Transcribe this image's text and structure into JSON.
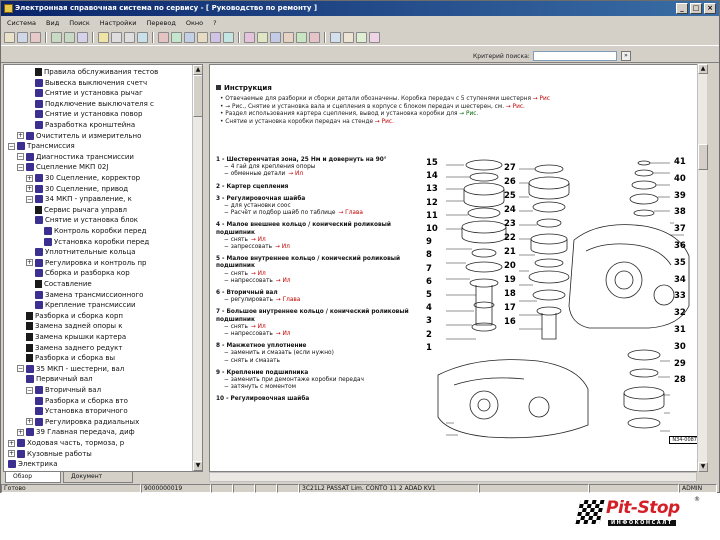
{
  "window": {
    "title": "Электронная справочная система по сервису - [ Руководство по ремонту ]",
    "buttons": [
      "_",
      "□",
      "×"
    ]
  },
  "menu": [
    "Система",
    "Вид",
    "Поиск",
    "Настройки",
    "Перевод",
    "Окно",
    "?"
  ],
  "search": {
    "label": "Критерий поиска:",
    "value": "",
    "go": "»"
  },
  "tree": {
    "items": [
      {
        "level": 4,
        "icon": "page",
        "expander": "",
        "label": "Правила обслуживания   тестов"
      },
      {
        "level": 4,
        "icon": "book",
        "expander": "",
        "label": "Вывеска    выключения   счетч"
      },
      {
        "level": 4,
        "icon": "book",
        "expander": "",
        "label": "Снятие   и установка  рычаг"
      },
      {
        "level": 4,
        "icon": "book",
        "expander": "",
        "label": "Подключение  выключателя  с"
      },
      {
        "level": 4,
        "icon": "book",
        "expander": "",
        "label": "Снятие и установка  повор"
      },
      {
        "level": 4,
        "icon": "book",
        "expander": "",
        "label": "Разработка  кронштейна"
      },
      {
        "level": 2,
        "icon": "book",
        "expander": "+",
        "label": "Очиститель   и   измерительно"
      },
      {
        "level": 1,
        "icon": "book",
        "expander": "−",
        "label": "Трансмиссия"
      },
      {
        "level": 2,
        "icon": "book",
        "expander": "−",
        "label": "Диагностика  трансмиссии"
      },
      {
        "level": 2,
        "icon": "book",
        "expander": "−",
        "label": "Сцепление   МКП  02J"
      },
      {
        "level": 3,
        "icon": "book",
        "expander": "+",
        "label": "30  Сцепление,  корректор"
      },
      {
        "level": 3,
        "icon": "book",
        "expander": "+",
        "label": "30  Сцепление,  привод"
      },
      {
        "level": 3,
        "icon": "book",
        "expander": "−",
        "label": "34  МКП  -  управление,  к"
      },
      {
        "level": 4,
        "icon": "page",
        "expander": "",
        "label": "Сервис  рычага  управл"
      },
      {
        "level": 4,
        "icon": "book",
        "expander": "",
        "label": "Снятие  и установка  блок"
      },
      {
        "level": 5,
        "icon": "book",
        "expander": "",
        "label": "Контроль  коробки  перед"
      },
      {
        "level": 5,
        "icon": "book",
        "expander": "",
        "label": "Установка  коробки  перед"
      },
      {
        "level": 4,
        "icon": "book",
        "expander": "",
        "label": "Уплотнительные  кольца"
      },
      {
        "level": 3,
        "icon": "book",
        "expander": "+",
        "label": "Регулировка  и  контроль  пр"
      },
      {
        "level": 4,
        "icon": "book",
        "expander": "",
        "label": "Сборка  и  разборка  кор"
      },
      {
        "level": 4,
        "icon": "page",
        "expander": "",
        "label": "Составление"
      },
      {
        "level": 4,
        "icon": "book",
        "expander": "",
        "label": "Замена  трансмиссионного"
      },
      {
        "level": 4,
        "icon": "book",
        "expander": "",
        "label": "Крепление  трансмиссии"
      },
      {
        "level": 3,
        "icon": "page",
        "expander": "",
        "label": "Разборка  и  сборка  корп"
      },
      {
        "level": 3,
        "icon": "page",
        "expander": "",
        "label": "Замена  задней  опоры  к"
      },
      {
        "level": 3,
        "icon": "page",
        "expander": "",
        "label": "Замена  крышки  картера"
      },
      {
        "level": 3,
        "icon": "page",
        "expander": "",
        "label": "Замена  заднего  редукт"
      },
      {
        "level": 3,
        "icon": "page",
        "expander": "",
        "label": "Разборка  и  сборка  вы"
      },
      {
        "level": 2,
        "icon": "book",
        "expander": "−",
        "label": "35  МКП  -  шестерни,   вал"
      },
      {
        "level": 3,
        "icon": "book",
        "expander": "",
        "label": "Первичный  вал"
      },
      {
        "level": 3,
        "icon": "book",
        "expander": "−",
        "label": "Вторичный  вал"
      },
      {
        "level": 4,
        "icon": "book",
        "expander": "",
        "label": "Разборка  и  сборка  вто"
      },
      {
        "level": 4,
        "icon": "book",
        "expander": "",
        "label": "Установка  вторичного"
      },
      {
        "level": 3,
        "icon": "book",
        "expander": "+",
        "label": "Регулировка  радиальных"
      },
      {
        "level": 2,
        "icon": "book",
        "expander": "+",
        "label": "39  Главная  передача,  диф"
      },
      {
        "level": 1,
        "icon": "book",
        "expander": "+",
        "label": "Ходовая  часть,  тормоза,  р"
      },
      {
        "level": 1,
        "icon": "book",
        "expander": "+",
        "label": "Кузовные  работы"
      },
      {
        "level": 1,
        "icon": "book",
        "expander": "",
        "label": "Электрика"
      }
    ]
  },
  "tabs": [
    "Обзор",
    "Документ"
  ],
  "content": {
    "title": "Инструкция",
    "intro": [
      {
        "text": "Отвечаемые для разборки и сборки детали  обозначены. Коробка передач  с 5 ступенями шестерня",
        "red": "→ Рис"
      },
      {
        "text": "→ Рис., Снятие и установка  вала  и  сцепления  в корпусе  с блоком передач и шестерен,  см.",
        "red": "→ Рис."
      },
      {
        "text": "Раздел использования  картера сцепления,  вывод и установка  коробки для  ",
        "red": "→ Рис."
      },
      {
        "text": "Снятие и установка  коробки  передач  на  стенде",
        "red": "→ Рис."
      }
    ],
    "steps": [
      {
        "title": "1 - Шестеренчатая  зона,  25 Нм и довернуть на 90°",
        "subs": [
          {
            "t": "4 гай  для  крепления  опоры",
            "r": ""
          },
          {
            "t": "обменные  детали",
            "r": "→ Ил"
          }
        ]
      },
      {
        "title": "2 - Картер  сцепления",
        "subs": []
      },
      {
        "title": "3 - Регулировочная  шайба",
        "subs": [
          {
            "t": "для  установки  соос",
            "r": ""
          },
          {
            "t": "Расчёт  и подбор  шайб  по  таблице",
            "r": "→ Глава"
          }
        ]
      },
      {
        "title": "4 - Малое  внешнее  кольцо / конический  роликовый  подшипник",
        "subs": [
          {
            "t": "снять",
            "r": "→ Ил"
          },
          {
            "t": "запрессовать",
            "r": "→ Ил"
          }
        ]
      },
      {
        "title": "5 - Малое  внутреннее  кольцо / конический  роликовый  подшипник",
        "subs": [
          {
            "t": "снять",
            "r": "→ Ил"
          },
          {
            "t": "напрессовать",
            "r": "→ Ил"
          }
        ]
      },
      {
        "title": "6 - Вторичный  вал",
        "subs": [
          {
            "t": "регулировать",
            "r": "→ Глава"
          }
        ]
      },
      {
        "title": "7 - Большое  внутреннее  кольцо / конический  роликовый  подшипник",
        "subs": [
          {
            "t": "снять",
            "r": "→ Ил"
          },
          {
            "t": "напрессовать",
            "r": "→ Ил"
          }
        ]
      },
      {
        "title": "8 - Манжетное  уплотнение",
        "subs": [
          {
            "t": "заменить  и  смазать  (если  нужно)",
            "r": ""
          },
          {
            "t": "снять  и  смазать",
            "r": ""
          }
        ]
      },
      {
        "title": "9 - Крепление  подшипника",
        "subs": [
          {
            "t": "заменить  при  демонтаже  коробки  передач",
            "r": ""
          },
          {
            "t": "затянуть  с  моментом",
            "r": ""
          }
        ]
      },
      {
        "title": "10 - Регулировочная  шайба",
        "subs": []
      }
    ],
    "callouts_left": [
      "15",
      "14",
      "13",
      "12",
      "11",
      "10",
      "9",
      "8",
      "7",
      "6",
      "5",
      "4",
      "3",
      "2",
      "1"
    ],
    "callouts_mid": [
      "27",
      "26",
      "25",
      "24",
      "23",
      "22",
      "21",
      "20",
      "19",
      "18",
      "17",
      "16"
    ],
    "callouts_right": [
      "41",
      "40",
      "39",
      "38",
      "37",
      "36",
      "35",
      "34",
      "33",
      "32",
      "31",
      "30",
      "29",
      "28"
    ],
    "figure_id": "N34-0087"
  },
  "status": [
    "Готово",
    "9000000019",
    "",
    "",
    "",
    "",
    "3C21L2  PASSAT  Lim.  CONTO  11 2   ADAD   KV1",
    "",
    "",
    "ADMIN"
  ],
  "logo": {
    "name": "Pit-Stop",
    "sub": "ИНФОКОНСАЛТ",
    "reg": "®"
  },
  "colors": {
    "titlebar": "#0a246a",
    "link_red": "#c00000",
    "link_green": "#006400",
    "brand": "#d41f26"
  }
}
